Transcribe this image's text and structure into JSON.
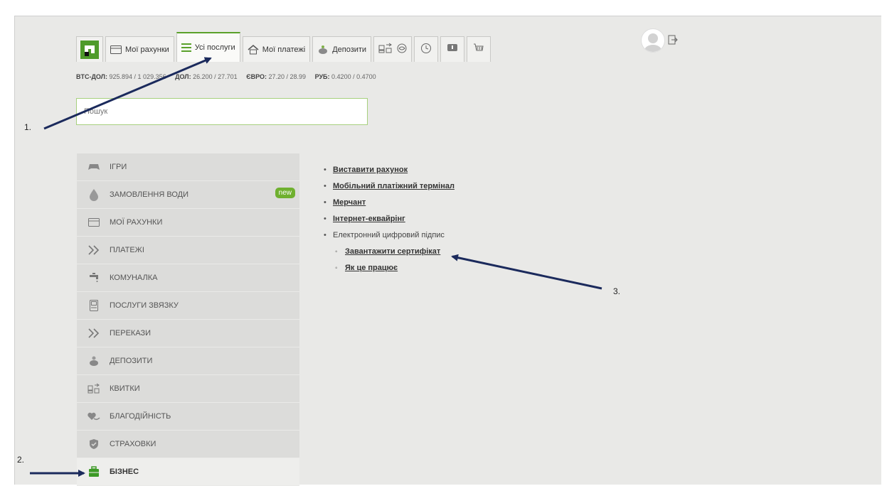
{
  "nav": {
    "tabs": [
      {
        "label": "Мої рахунки",
        "icon": "card-icon"
      },
      {
        "label": "Усі послуги",
        "icon": "list-icon"
      },
      {
        "label": "Мої платежі",
        "icon": "house-icon"
      },
      {
        "label": "Депозити",
        "icon": "piggy-bank-icon"
      }
    ],
    "icon_tabs": [
      "tickets-icon",
      "globe-icon",
      "timer-icon",
      "chat-icon",
      "cart-icon"
    ]
  },
  "rates": [
    {
      "label": "BTC-ДОЛ:",
      "value": "925.894 / 1 029.356"
    },
    {
      "label": "ДОЛ:",
      "value": "26.200 / 27.701"
    },
    {
      "label": "ЄВРО:",
      "value": "27.20 / 28.99"
    },
    {
      "label": "РУБ:",
      "value": "0.4200 / 0.4700"
    }
  ],
  "search": {
    "placeholder": "Пошук"
  },
  "sidebar": {
    "items": [
      {
        "label": "ІГРИ",
        "icon": "gamepad-icon"
      },
      {
        "label": "ЗАМОВЛЕННЯ ВОДИ",
        "icon": "water-drop-icon",
        "badge": "new"
      },
      {
        "label": "МОЇ РАХУНКИ",
        "icon": "card-icon"
      },
      {
        "label": "ПЛАТЕЖІ",
        "icon": "double-chevron-icon"
      },
      {
        "label": "КОМУНАЛКА",
        "icon": "tap-icon"
      },
      {
        "label": "ПОСЛУГИ ЗВЯЗКУ",
        "icon": "phone-icon"
      },
      {
        "label": "ПЕРЕКАЗИ",
        "icon": "double-chevron-icon"
      },
      {
        "label": "ДЕПОЗИТИ",
        "icon": "piggy-bank-icon"
      },
      {
        "label": "КВИТКИ",
        "icon": "tickets-icon"
      },
      {
        "label": "БЛАГОДІЙНІСТЬ",
        "icon": "heart-hand-icon"
      },
      {
        "label": "СТРАХОВКИ",
        "icon": "shield-icon"
      },
      {
        "label": "БІЗНЕС",
        "icon": "briefcase-icon"
      }
    ]
  },
  "content": {
    "links": [
      {
        "label": "Виставити рахунок"
      },
      {
        "label": "Мобільний платіжний термінал"
      },
      {
        "label": "Мерчант"
      },
      {
        "label": "Інтернет-еквайрінг"
      }
    ],
    "section_label": "Електронний цифровий підпис",
    "sublinks": [
      {
        "label": "Завантажити сертифікат"
      },
      {
        "label": "Як це працює"
      }
    ]
  },
  "annotations": {
    "one": "1.",
    "two": "2.",
    "three": "3."
  },
  "colors": {
    "accent": "#5aa12b",
    "badge": "#6fb02f",
    "arrow": "#1b2a5c"
  }
}
